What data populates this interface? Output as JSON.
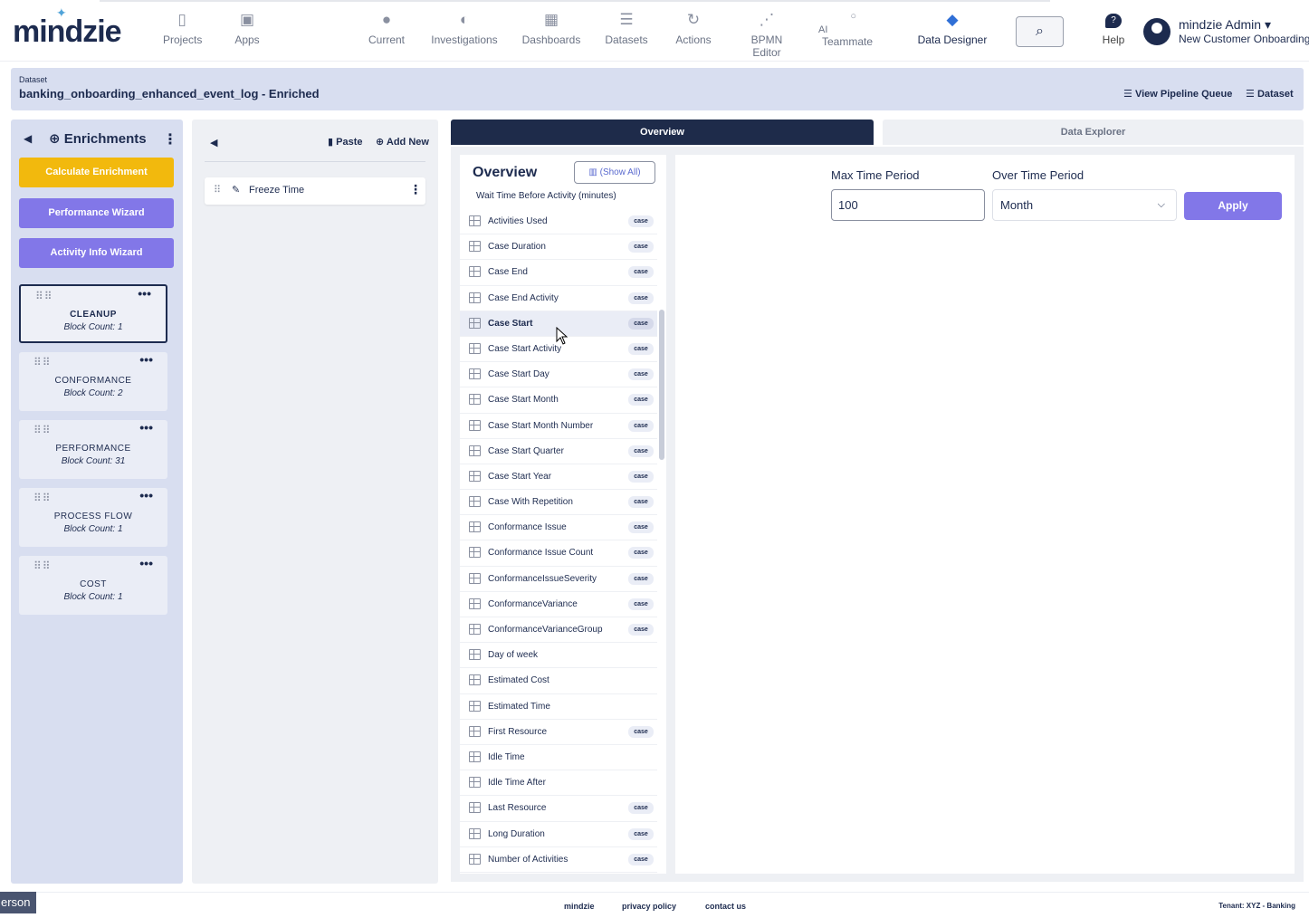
{
  "app": {
    "logo": "mindzie"
  },
  "nav": {
    "items": [
      {
        "label": "Projects",
        "icon": "file-icon"
      },
      {
        "label": "Apps",
        "icon": "apps-icon"
      },
      {
        "label": "Current",
        "icon": "location-pin-icon"
      },
      {
        "label": "Investigations",
        "icon": "investigations-icon"
      },
      {
        "label": "Dashboards",
        "icon": "dashboard-grid-icon"
      },
      {
        "label": "Datasets",
        "icon": "database-icon"
      },
      {
        "label": "Actions",
        "icon": "actions-icon"
      },
      {
        "label": "BPMN Editor",
        "icon": "bpmn-icon"
      },
      {
        "label": "AI",
        "icon": "chat-bubble-icon"
      },
      {
        "label": "Teammate",
        "icon": ""
      },
      {
        "label": "Data Designer",
        "icon": "data-designer-icon"
      }
    ],
    "help_label": "Help",
    "help_glyph": "?",
    "user_name": "mindzie Admin",
    "user_project": "New Customer Onboarding"
  },
  "dataset_bar": {
    "label": "Dataset",
    "title": "banking_onboarding_enhanced_event_log - Enriched",
    "view_pipeline": "View Pipeline Queue",
    "dataset_link": "Dataset"
  },
  "enrichments": {
    "title": "Enrichments",
    "buttons": {
      "calculate": "Calculate Enrichment",
      "performance_wizard": "Performance Wizard",
      "activity_wizard": "Activity Info Wizard"
    },
    "blocks": [
      {
        "name": "CLEANUP",
        "count": "Block Count: 1"
      },
      {
        "name": "CONFORMANCE",
        "count": "Block Count: 2"
      },
      {
        "name": "PERFORMANCE",
        "count": "Block Count: 31"
      },
      {
        "name": "PROCESS FLOW",
        "count": "Block Count: 1"
      },
      {
        "name": "COST",
        "count": "Block Count: 1"
      }
    ]
  },
  "pipeline": {
    "paste": "Paste",
    "add_new": "Add New",
    "items": [
      {
        "label": "Freeze Time"
      }
    ]
  },
  "tabs": {
    "overview": "Overview",
    "data_explorer": "Data Explorer"
  },
  "overview": {
    "title": "Overview",
    "show_all": "(Show All)",
    "top_row": "Wait Time Before Activity (minutes)",
    "rows": [
      {
        "label": "Activities Used",
        "badge": "case"
      },
      {
        "label": "Case Duration",
        "badge": "case"
      },
      {
        "label": "Case End",
        "badge": "case"
      },
      {
        "label": "Case End Activity",
        "badge": "case"
      },
      {
        "label": "Case Start",
        "badge": "case"
      },
      {
        "label": "Case Start Activity",
        "badge": "case"
      },
      {
        "label": "Case Start Day",
        "badge": "case"
      },
      {
        "label": "Case Start Month",
        "badge": "case"
      },
      {
        "label": "Case Start Month Number",
        "badge": "case"
      },
      {
        "label": "Case Start Quarter",
        "badge": "case"
      },
      {
        "label": "Case Start Year",
        "badge": "case"
      },
      {
        "label": "Case With Repetition",
        "badge": "case"
      },
      {
        "label": "Conformance Issue",
        "badge": "case"
      },
      {
        "label": "Conformance Issue Count",
        "badge": "case"
      },
      {
        "label": "ConformanceIssueSeverity",
        "badge": "case"
      },
      {
        "label": "ConformanceVariance",
        "badge": "case"
      },
      {
        "label": "ConformanceVarianceGroup",
        "badge": "case"
      },
      {
        "label": "Day of week",
        "badge": ""
      },
      {
        "label": "Estimated Cost",
        "badge": ""
      },
      {
        "label": "Estimated Time",
        "badge": ""
      },
      {
        "label": "First Resource",
        "badge": "case"
      },
      {
        "label": "Idle Time",
        "badge": ""
      },
      {
        "label": "Idle Time After",
        "badge": ""
      },
      {
        "label": "Last Resource",
        "badge": "case"
      },
      {
        "label": "Long Duration",
        "badge": "case"
      },
      {
        "label": "Number of Activities",
        "badge": "case"
      }
    ]
  },
  "form": {
    "max_label": "Max Time Period",
    "max_value": "100",
    "over_label": "Over Time Period",
    "over_value": "Month",
    "apply": "Apply"
  },
  "footer": {
    "brand": "mindzie",
    "privacy": "privacy policy",
    "contact": "contact us",
    "tenant": "Tenant: XYZ - Banking",
    "person_tab": "erson"
  }
}
